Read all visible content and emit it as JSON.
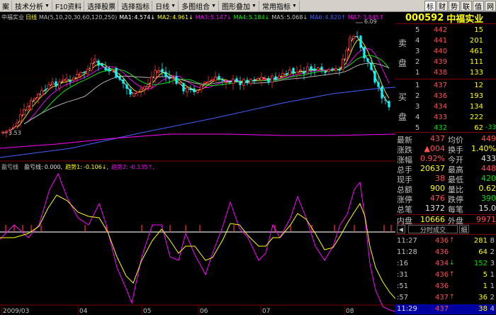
{
  "toolbar": {
    "items": [
      {
        "label": "案",
        "dd": false
      },
      {
        "label": "技术分析",
        "dd": true
      },
      {
        "label": "F10资料",
        "dd": false
      },
      {
        "label": "选择股票",
        "dd": false
      },
      {
        "label": "选择指标",
        "dd": false
      },
      {
        "label": "日线",
        "dd": true
      },
      {
        "label": "多图组合",
        "dd": true
      },
      {
        "label": "图形叠加",
        "dd": true
      },
      {
        "label": "常用指标",
        "dd": true
      }
    ],
    "tabs": [
      {
        "label": "标",
        "active": true
      },
      {
        "label": "财",
        "active": false
      },
      {
        "label": "势",
        "active": false
      },
      {
        "label": "联",
        "active": false
      },
      {
        "label": "值",
        "active": false
      },
      {
        "label": "网",
        "active": false
      }
    ]
  },
  "main": {
    "title": "中福实业",
    "period": "日线",
    "ma_params": "MA(5,10,20,30,60,120,250)",
    "ma_values": [
      {
        "name": "MA1:",
        "value": "4.574",
        "arrow": "↓",
        "color": "#ffffff"
      },
      {
        "name": "MA2:",
        "value": "4.961",
        "arrow": "↓",
        "color": "#ffff00"
      },
      {
        "name": "MA3:",
        "value": "5.147",
        "arrow": "↓",
        "color": "#ff00ff"
      },
      {
        "name": "MA4:",
        "value": "5.184",
        "arrow": "↓",
        "color": "#00ff00"
      },
      {
        "name": "MA5:",
        "value": "5.068",
        "arrow": "↓",
        "color": "#c0c0c0"
      },
      {
        "name": "MA6:",
        "value": "4.820",
        "arrow": "↑",
        "color": "#4060ff"
      },
      {
        "name": "MA7:",
        "value": "3.845",
        "arrow": "↑",
        "color": "#ff00ff"
      }
    ],
    "high_label": "6.09",
    "low_label": "3.53"
  },
  "indicator": {
    "name": "盈亏线",
    "line_label": "盈亏线:",
    "line_value": "0.000,",
    "trend1_label": "趋势1:",
    "trend1_value": "-0.106",
    "trend1_arrow": "↓,",
    "trend2_label": "趋势2:",
    "trend2_value": "-0.135",
    "trend2_arrow": "↑,"
  },
  "xaxis": {
    "labels": [
      "2009/03",
      "04",
      "05",
      "06",
      "07",
      "08"
    ]
  },
  "panel": {
    "code": "000592",
    "name": "中福实业",
    "sell_label": [
      "卖",
      "盘"
    ],
    "buy_label": [
      "买",
      "盘"
    ],
    "sells": [
      {
        "idx": "5",
        "price": "442",
        "vol": "15",
        "chg": ""
      },
      {
        "idx": "4",
        "price": "441",
        "vol": "201",
        "chg": ""
      },
      {
        "idx": "3",
        "price": "440",
        "vol": "461",
        "chg": ""
      },
      {
        "idx": "2",
        "price": "439",
        "vol": "111",
        "chg": ""
      },
      {
        "idx": "1",
        "price": "438",
        "vol": "133",
        "chg": ""
      }
    ],
    "buys": [
      {
        "idx": "1",
        "price": "437",
        "vol": "12",
        "chg": "",
        "green": false
      },
      {
        "idx": "2",
        "price": "436",
        "vol": "193",
        "chg": "",
        "green": false
      },
      {
        "idx": "3",
        "price": "434",
        "vol": "134",
        "chg": "",
        "green": false
      },
      {
        "idx": "4",
        "price": "433",
        "vol": "222",
        "chg": "",
        "green": false
      },
      {
        "idx": "5",
        "price": "432",
        "vol": "62",
        "chg": "-33",
        "green": true
      }
    ],
    "quote": [
      {
        "l1": "最新",
        "v1": "437",
        "c1": "red",
        "l2": "均价",
        "v2": "449",
        "c2": "red"
      },
      {
        "l1": "涨跌",
        "v1": "▲004",
        "c1": "red",
        "l2": "换手",
        "v2": "1.40%",
        "c2": "yellow"
      },
      {
        "l1": "涨幅",
        "v1": "0.92%",
        "c1": "red",
        "l2": "今开",
        "v2": "433",
        "c2": "white"
      },
      {
        "l1": "总手",
        "v1": "20637",
        "c1": "yellow",
        "l2": "最高",
        "v2": "448",
        "c2": "red"
      },
      {
        "l1": "现手",
        "v1": "38",
        "c1": "red",
        "l2": "最低",
        "v2": "420",
        "c2": "green"
      },
      {
        "l1": "总额",
        "v1": "900",
        "c1": "yellow",
        "l2": "量比",
        "v2": "0.62",
        "c2": "yellow"
      },
      {
        "l1": "涨停",
        "v1": "476",
        "c1": "red",
        "l2": "跌停",
        "v2": "390",
        "c2": "green"
      },
      {
        "l1": "总笔",
        "v1": "1372",
        "c1": "white",
        "l2": "每笔",
        "v2": "15.0",
        "c2": "white"
      }
    ],
    "inner_label": "内盘",
    "inner_value": "10666",
    "outer_label": "外盘",
    "outer_value": "9971",
    "tick_tab": "分时成交",
    "tick_tab2": "细",
    "ticks": [
      {
        "time": "11:27",
        "price": "436",
        "arrow": "↑",
        "vol": "281",
        "n": "8",
        "up": true,
        "sel": false
      },
      {
        "time": "11:28",
        "price": "436",
        "arrow": "",
        "vol": "64",
        "n": "2",
        "up": true,
        "sel": false
      },
      {
        "time": ":16",
        "price": "434",
        "arrow": "↓",
        "vol": "152",
        "n": "3",
        "up": false,
        "sel": false
      },
      {
        "time": ":31",
        "price": "436",
        "arrow": "↑",
        "vol": "5",
        "n": "1",
        "up": true,
        "sel": false
      },
      {
        "time": ":51",
        "price": "436",
        "arrow": "",
        "vol": "1",
        "n": "1",
        "up": true,
        "sel": false
      },
      {
        "time": ":57",
        "price": "437",
        "arrow": "↑",
        "vol": "36",
        "n": "2",
        "up": true,
        "sel": false
      },
      {
        "time": "11:29",
        "price": "437",
        "arrow": "",
        "vol": "38",
        "n": "4",
        "up": true,
        "sel": true
      }
    ]
  }
}
